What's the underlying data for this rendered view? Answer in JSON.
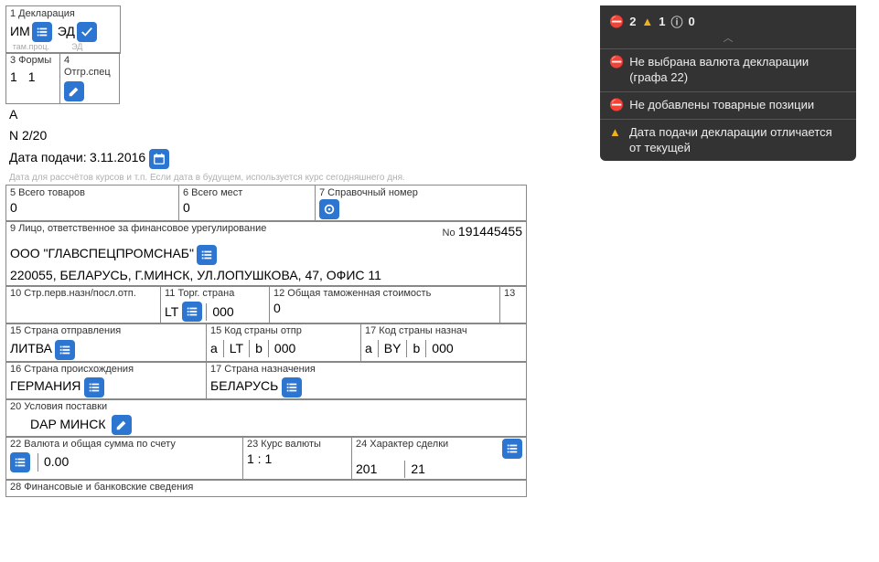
{
  "box1": {
    "label": "1 Декларация",
    "vals": [
      "ИМ",
      "ЭД"
    ],
    "subs": [
      "там.проц.",
      "ЭД"
    ]
  },
  "box3": {
    "label": "3 Формы",
    "v1": "1",
    "v2": "1"
  },
  "box4": {
    "label": "4 Отгр.спец"
  },
  "status": {
    "a": "A",
    "n": "N 2/20"
  },
  "date": {
    "label": "Дата подачи:",
    "val": "3.11.2016",
    "note": "Дата для рассчётов курсов и т.п. Если дата в будущем, используется курс сегодняшнего дня."
  },
  "box5": {
    "label": "5 Всего товаров",
    "val": "0"
  },
  "box6": {
    "label": "6 Всего мест",
    "val": "0"
  },
  "box7": {
    "label": "7 Справочный номер"
  },
  "box9": {
    "label": "9 Лицо, ответственное за финансовое урегулирование",
    "no_lbl": "No",
    "no": "191445455",
    "name": "ООО \"ГЛАВСПЕЦПРОМСНАБ\"",
    "addr": "220055, БЕЛАРУСЬ, Г.МИНСК, УЛ.ЛОПУШКОВА, 47, ОФИС 11"
  },
  "box10": {
    "label": "10 Стр.перв.назн/посл.отп."
  },
  "box11": {
    "label": "11 Торг. страна",
    "v1": "LT",
    "v2": "000"
  },
  "box12": {
    "label": "12 Общая таможенная стоимость",
    "val": "0"
  },
  "box13": {
    "label": "13"
  },
  "box15": {
    "label": "15 Страна отправления",
    "val": "ЛИТВА"
  },
  "box15a": {
    "label": "15 Код страны отпр",
    "a": "a",
    "v1": "LT",
    "b": "b",
    "v2": "000"
  },
  "box17a": {
    "label": "17 Код страны назнач",
    "a": "a",
    "v1": "BY",
    "b": "b",
    "v2": "000"
  },
  "box16": {
    "label": "16 Страна происхождения",
    "val": "ГЕРМАНИЯ"
  },
  "box17": {
    "label": "17 Страна назначения",
    "val": "БЕЛАРУСЬ"
  },
  "box20": {
    "label": "20 Условия поставки",
    "val": "DAP МИНСК"
  },
  "box22": {
    "label": "22 Валюта и общая сумма по счету",
    "val": "0.00"
  },
  "box23": {
    "label": "23 Курс валюты",
    "val": "1 : 1"
  },
  "box24": {
    "label": "24 Характер сделки",
    "v1": "201",
    "v2": "21"
  },
  "box28": {
    "label": "28 Финансовые и банковские сведения"
  },
  "notif": {
    "counts": {
      "err": "2",
      "warn": "1",
      "info": "0"
    },
    "items": [
      {
        "type": "err",
        "text": "Не выбрана валюта декларации (графа 22)"
      },
      {
        "type": "err",
        "text": "Не добавлены товарные позиции"
      },
      {
        "type": "warn",
        "text": "Дата подачи декларации отличается от текущей"
      }
    ]
  }
}
